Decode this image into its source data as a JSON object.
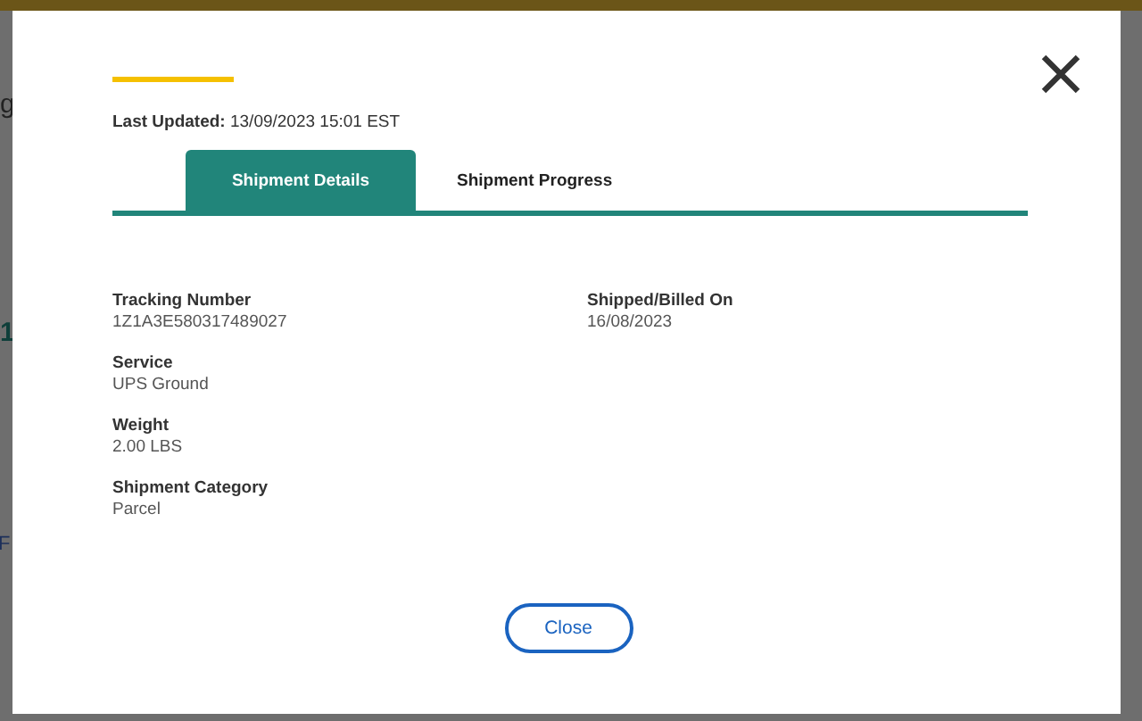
{
  "background": {
    "fragments": [
      {
        "text": "g",
        "kind": "plain"
      },
      {
        "text": "1",
        "kind": "heading"
      },
      {
        "text": "F",
        "kind": "link"
      }
    ]
  },
  "modal": {
    "last_updated": {
      "label": "Last Updated:",
      "value": "13/09/2023 15:01 EST"
    },
    "tabs": [
      {
        "label": "Shipment Details",
        "selected": true
      },
      {
        "label": "Shipment Progress",
        "selected": false
      }
    ],
    "columns": [
      [
        {
          "label": "Tracking Number",
          "value": "1Z1A3E580317489027"
        },
        {
          "label": "Service",
          "value": "UPS Ground"
        },
        {
          "label": "Weight",
          "value": "2.00 LBS"
        },
        {
          "label": "Shipment Category",
          "value": "Parcel"
        }
      ],
      [
        {
          "label": "Shipped/Billed On",
          "value": "16/08/2023"
        }
      ]
    ],
    "close_button": "Close"
  }
}
